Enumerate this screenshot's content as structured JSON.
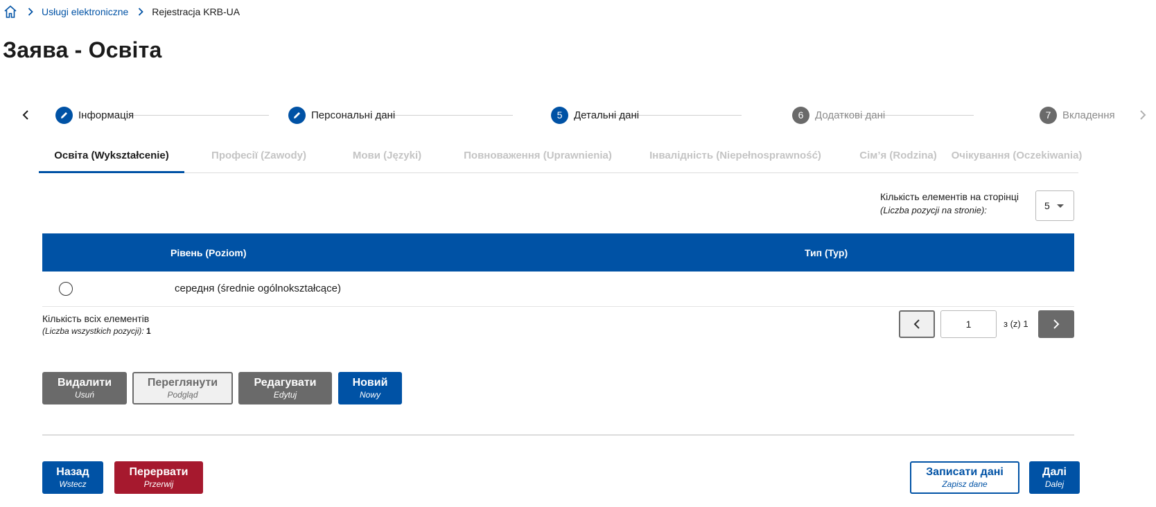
{
  "breadcrumb": {
    "home_icon": "home-icon",
    "items": [
      "Usługi elektroniczne",
      "Rejestracja KRB-UA"
    ]
  },
  "page": {
    "title": "Заява - Освіта"
  },
  "stepper": {
    "steps": [
      {
        "marker": "",
        "label": "Інформація",
        "state": "done"
      },
      {
        "marker": "",
        "label": "Персональні дані",
        "state": "done"
      },
      {
        "marker": "5",
        "label": "Детальні дані",
        "state": "current"
      },
      {
        "marker": "6",
        "label": "Додаткові дані",
        "state": "upcoming"
      },
      {
        "marker": "7",
        "label": "Вкладення",
        "state": "upcoming"
      }
    ]
  },
  "tabs": [
    "Освіта (Wykształcenie)",
    "Професії (Zawody)",
    "Мови (Języki)",
    "Повноваження (Uprawnienia)",
    "Інвалідність (Niepełnosprawność)",
    "Сім’я (Rodzina)",
    "Очікування (Oczekiwania)"
  ],
  "per_page": {
    "label": "Кількість елементів на сторінці",
    "label_pl": "(Liczba pozycji na stronie):",
    "value": "5"
  },
  "table": {
    "columns": [
      "Рівень (Poziom)",
      "Тип (Typ)"
    ],
    "rows": [
      {
        "level": "середня (średnie ogólnokształcące)",
        "type": ""
      }
    ]
  },
  "total": {
    "label": "Кількість всіх елементів",
    "label_pl": "(Liczba wszystkich pozycji):",
    "count": "1"
  },
  "pager": {
    "page": "1",
    "of_text": "з (z) 1"
  },
  "actions": {
    "delete": {
      "main": "Видалити",
      "sub": "Usuń"
    },
    "view": {
      "main": "Переглянути",
      "sub": "Podgląd"
    },
    "edit": {
      "main": "Редагувати",
      "sub": "Edytuj"
    },
    "new": {
      "main": "Новий",
      "sub": "Nowy"
    }
  },
  "footer": {
    "back": {
      "main": "Назад",
      "sub": "Wstecz"
    },
    "abort": {
      "main": "Перервати",
      "sub": "Przerwij"
    },
    "save": {
      "main": "Записати дані",
      "sub": "Zapisz dane"
    },
    "next": {
      "main": "Далі",
      "sub": "Dalej"
    }
  },
  "colors": {
    "primary": "#0052a5",
    "danger": "#a6192e",
    "gray": "#6a6a6a"
  }
}
